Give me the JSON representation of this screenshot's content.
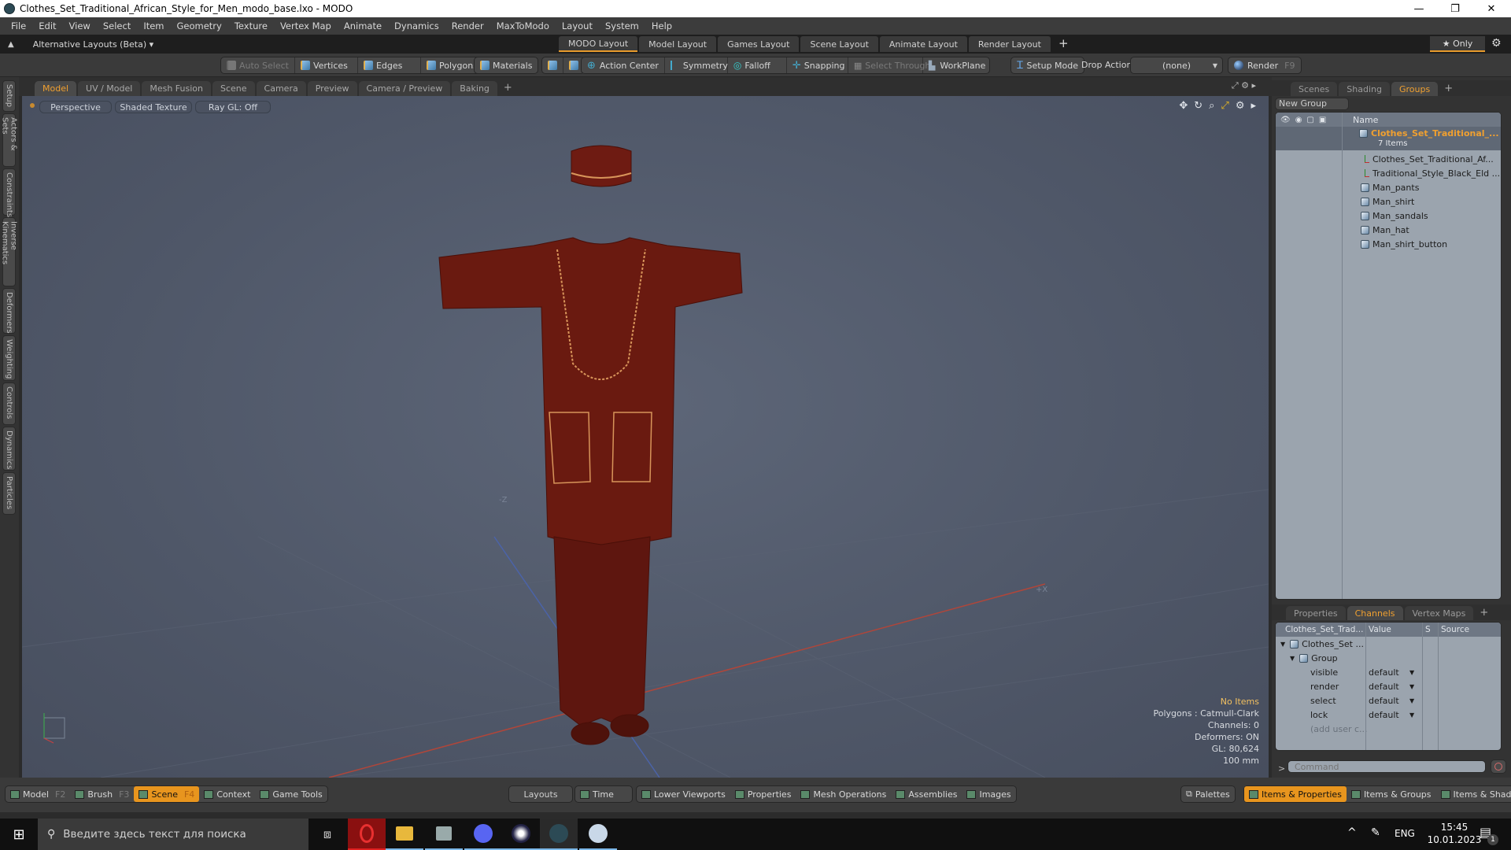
{
  "window": {
    "title": "Clothes_Set_Traditional_African_Style_for_Men_modo_base.lxo - MODO",
    "controls": {
      "minimize": "—",
      "maximize": "❐",
      "close": "✕"
    }
  },
  "menu": [
    "File",
    "Edit",
    "View",
    "Select",
    "Item",
    "Geometry",
    "Texture",
    "Vertex Map",
    "Animate",
    "Dynamics",
    "Render",
    "MaxToModo",
    "Layout",
    "System",
    "Help"
  ],
  "layoutbar": {
    "alt_layouts": "Alternative Layouts (Beta) ▾",
    "tabs": [
      "MODO Layout",
      "Model Layout",
      "Games Layout",
      "Scene Layout",
      "Animate Layout",
      "Render Layout"
    ],
    "active_tab": "MODO Layout",
    "add": "+",
    "only": "★  Only",
    "gear": "⚙"
  },
  "toolbar": {
    "auto_select": "Auto Select",
    "vertices": "Vertices",
    "edges": "Edges",
    "polygons": "Polygons",
    "materials": "Materials",
    "action_center": "Action Center",
    "symmetry": "Symmetry",
    "falloff": "Falloff",
    "snapping": "Snapping",
    "select_through": "Select Through",
    "workplane": "WorkPlane",
    "setup_mode": "Setup Mode",
    "drop_action_label": "Drop Action",
    "drop_action_value": "(none)",
    "render": "Render",
    "render_key": "F9"
  },
  "left_tabs": [
    "Setup",
    "Actors & Sets",
    "Constraints",
    "Inverse Kinematics",
    "Deformers",
    "Weighting",
    "Controls",
    "Dynamics",
    "Particles"
  ],
  "viewport_tabs": [
    "Model",
    "UV / Model",
    "Mesh Fusion",
    "Scene",
    "Camera",
    "Preview",
    "Camera / Preview",
    "Baking"
  ],
  "viewport_tabs_add": "+",
  "viewport": {
    "view_mode": "Perspective",
    "shading": "Shaded Texture",
    "raygl": "Ray GL: Off",
    "axis_z_label": "-Z",
    "axis_x_label": "+X",
    "info": {
      "items": "No Items",
      "polygons": "Polygons : Catmull-Clark",
      "channels": "Channels: 0",
      "deformers": "Deformers: ON",
      "gl": "GL: 80,624",
      "scale": "100 mm"
    }
  },
  "groups_panel": {
    "tabs": [
      "Scenes",
      "Shading",
      "Groups"
    ],
    "active_tab": "Groups",
    "new_group": "New Group",
    "col_name": "Name",
    "group_name": "Clothes_Set_Traditional_...",
    "group_count": "7 Items",
    "items": [
      {
        "name": "Clothes_Set_Traditional_Af...",
        "type": "locator"
      },
      {
        "name": "Traditional_Style_Black_Eld ...",
        "type": "locator"
      },
      {
        "name": "Man_pants",
        "type": "mesh"
      },
      {
        "name": "Man_shirt",
        "type": "mesh"
      },
      {
        "name": "Man_sandals",
        "type": "mesh"
      },
      {
        "name": "Man_hat",
        "type": "mesh"
      },
      {
        "name": "Man_shirt_button",
        "type": "mesh"
      }
    ]
  },
  "channels_panel": {
    "tabs": [
      "Properties",
      "Channels",
      "Vertex Maps"
    ],
    "active_tab": "Channels",
    "columns": [
      "Clothes_Set_Trad...",
      "Value",
      "S",
      "Source"
    ],
    "root": "Clothes_Set ...",
    "group": "Group",
    "rows": [
      {
        "name": "visible",
        "value": "default"
      },
      {
        "name": "render",
        "value": "default"
      },
      {
        "name": "select",
        "value": "default"
      },
      {
        "name": "lock",
        "value": "default"
      }
    ],
    "add_user": "(add user c...",
    "command_placeholder": "Command",
    "prompt": ">"
  },
  "bottombar": {
    "left": [
      {
        "label": "Model",
        "key": "F2"
      },
      {
        "label": "Brush",
        "key": "F3"
      },
      {
        "label": "Scene",
        "key": "F4",
        "active": true
      },
      {
        "label": "Context",
        "key": ""
      },
      {
        "label": "Game Tools",
        "key": ""
      }
    ],
    "center": [
      "Layouts",
      "Time",
      "Lower Viewports",
      "Properties",
      "Mesh Operations",
      "Assemblies",
      "Images"
    ],
    "right": [
      "Palettes",
      "Items & Properties",
      "Items & Groups",
      "Items & Shading"
    ],
    "right_active": "Items & Properties"
  },
  "taskbar": {
    "search_placeholder": "Введите здесь текст для поиска",
    "lang": "ENG",
    "time": "15:45",
    "date": "10.01.2023",
    "notifications": "1",
    "apps": [
      "opera",
      "file-explorer",
      "task-manager",
      "discord",
      "cinema4d",
      "modo",
      "paint"
    ]
  },
  "colors": {
    "accent": "#e8951e",
    "active_tab_text": "#f0a030",
    "viewport_bg": "#525a6b"
  }
}
